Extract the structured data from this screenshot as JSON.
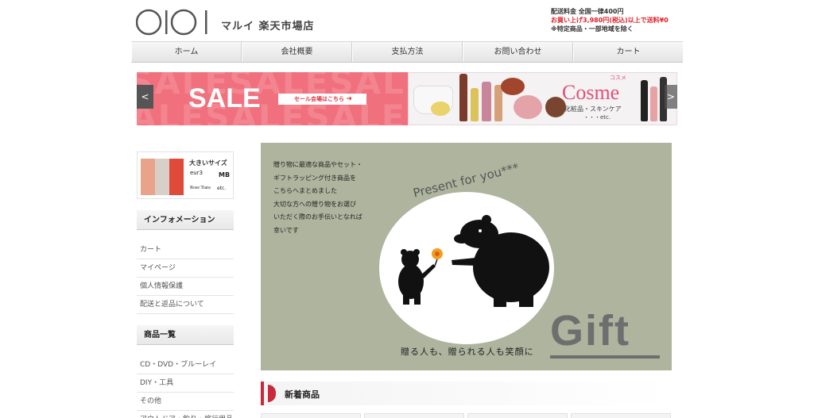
{
  "header": {
    "logo_text": "OIOI",
    "shop_name": "マルイ 楽天市場店",
    "shipping_line1": "配送料金 全国一律400円",
    "shipping_line2": "お買い上げ3,980円(税込)以上で送料¥0",
    "shipping_line3": "※特定商品・一部地域を除く"
  },
  "nav": {
    "items": [
      "ホーム",
      "会社概要",
      "支払方法",
      "お問い合わせ",
      "カート"
    ]
  },
  "banner": {
    "sale_title": "SALE",
    "sale_bg_text": "SALESALESALESALE",
    "sale_button": "セール会場はこちら",
    "prev": "<",
    "next": ">",
    "cosme_title": "Cosme",
    "cosme_ruby": "コスメ",
    "cosme_sub": "化粧品・スキンケア",
    "cosme_etc": "・・・etc."
  },
  "sidebar": {
    "size_banner": {
      "title": "大きいサイズ",
      "eur": "eur3",
      "mb": "MB",
      "rose": "Rose Tiara",
      "etc": "etc."
    },
    "info_heading": "インフォメーション",
    "info_links": [
      "カート",
      "マイページ",
      "個人情報保護",
      "配送と返品について"
    ],
    "products_heading": "商品一覧",
    "product_links": [
      "CD・DVD・ブルーレイ",
      "DIY・工具",
      "その他",
      "アウトドア・釣り・旅行用品"
    ]
  },
  "gift_banner": {
    "text_lines": [
      "贈り物に最適な商品やセット・",
      "ギフトラッピング付き商品を",
      "こちらへまとめました",
      "大切な方への贈り物をお選び",
      "いただく際のお手伝いとなれば",
      "幸いです"
    ],
    "present": "Present for you***",
    "word": "Gift",
    "caption": "贈る人も、贈られる人も笑顔に"
  },
  "new_section": {
    "heading": "新着商品"
  }
}
